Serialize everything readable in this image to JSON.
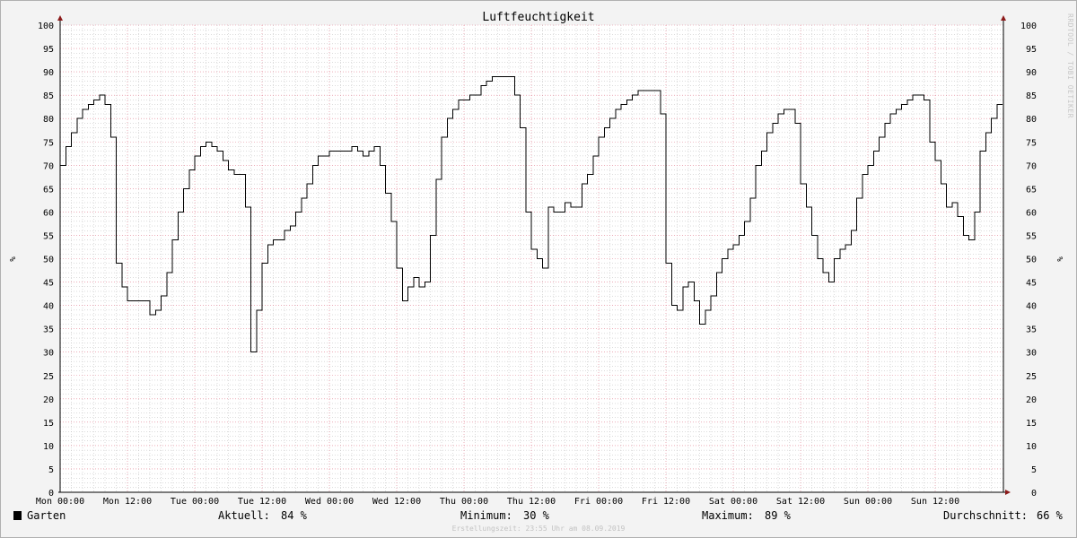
{
  "chart_data": {
    "type": "line",
    "title": "Luftfeuchtigkeit",
    "ylabel": "%",
    "ylim": [
      0,
      100
    ],
    "yticks": [
      0,
      5,
      10,
      15,
      20,
      25,
      30,
      35,
      40,
      45,
      50,
      55,
      60,
      65,
      70,
      75,
      80,
      85,
      90,
      95,
      100
    ],
    "xlabels": [
      "Mon 00:00",
      "Mon 12:00",
      "Tue 00:00",
      "Tue 12:00",
      "Wed 00:00",
      "Wed 12:00",
      "Thu 00:00",
      "Thu 12:00",
      "Fri 00:00",
      "Fri 12:00",
      "Sat 00:00",
      "Sat 12:00",
      "Sun 00:00",
      "Sun 12:00"
    ],
    "xlim_hours": [
      0,
      168
    ],
    "grid": true,
    "series": [
      {
        "name": "Garten",
        "color": "#000000",
        "x_hours": [
          0,
          1,
          2,
          3,
          4,
          5,
          6,
          7,
          8,
          9,
          10,
          11,
          12,
          13,
          14,
          15,
          16,
          17,
          18,
          19,
          20,
          21,
          22,
          23,
          24,
          25,
          26,
          27,
          28,
          29,
          30,
          31,
          32,
          33,
          34,
          35,
          36,
          37,
          38,
          39,
          40,
          41,
          42,
          43,
          44,
          45,
          46,
          47,
          48,
          49,
          50,
          51,
          52,
          53,
          54,
          55,
          56,
          57,
          58,
          59,
          60,
          61,
          62,
          63,
          64,
          65,
          66,
          67,
          68,
          69,
          70,
          71,
          72,
          73,
          74,
          75,
          76,
          77,
          78,
          79,
          80,
          81,
          82,
          83,
          84,
          85,
          86,
          87,
          88,
          89,
          90,
          91,
          92,
          93,
          94,
          95,
          96,
          97,
          98,
          99,
          100,
          101,
          102,
          103,
          104,
          105,
          106,
          107,
          108,
          109,
          110,
          111,
          112,
          113,
          114,
          115,
          116,
          117,
          118,
          119,
          120,
          121,
          122,
          123,
          124,
          125,
          126,
          127,
          128,
          129,
          130,
          131,
          132,
          133,
          134,
          135,
          136,
          137,
          138,
          139,
          140,
          141,
          142,
          143,
          144,
          145,
          146,
          147,
          148,
          149,
          150,
          151,
          152,
          153,
          154,
          155,
          156,
          157,
          158,
          159,
          160,
          161,
          162,
          163,
          164,
          165,
          166,
          167
        ],
        "values": [
          70,
          74,
          77,
          80,
          82,
          83,
          84,
          85,
          83,
          76,
          49,
          44,
          41,
          41,
          41,
          41,
          38,
          39,
          42,
          47,
          54,
          60,
          65,
          69,
          72,
          74,
          75,
          74,
          73,
          71,
          69,
          68,
          68,
          61,
          30,
          39,
          49,
          53,
          54,
          54,
          56,
          57,
          60,
          63,
          66,
          70,
          72,
          72,
          73,
          73,
          73,
          73,
          74,
          73,
          72,
          73,
          74,
          70,
          64,
          58,
          48,
          41,
          44,
          46,
          44,
          45,
          55,
          67,
          76,
          80,
          82,
          84,
          84,
          85,
          85,
          87,
          88,
          89,
          89,
          89,
          89,
          85,
          78,
          60,
          52,
          50,
          48,
          61,
          60,
          60,
          62,
          61,
          61,
          66,
          68,
          72,
          76,
          78,
          80,
          82,
          83,
          84,
          85,
          86,
          86,
          86,
          86,
          81,
          49,
          40,
          39,
          44,
          45,
          41,
          36,
          39,
          42,
          47,
          50,
          52,
          53,
          55,
          58,
          63,
          70,
          73,
          77,
          79,
          81,
          82,
          82,
          79,
          66,
          61,
          55,
          50,
          47,
          45,
          50,
          52,
          53,
          56,
          63,
          68,
          70,
          73,
          76,
          79,
          81,
          82,
          83,
          84,
          85,
          85,
          84,
          75,
          71,
          66,
          61,
          62,
          59,
          55,
          54,
          60,
          73,
          77,
          80,
          83,
          84
        ]
      }
    ]
  },
  "watermark": "RRDTOOL / TOBI OETIKER",
  "legend": {
    "series_label": "Garten",
    "current_label": "Aktuell:",
    "current_value": "84 %",
    "min_label": "Minimum:",
    "min_value": "30 %",
    "max_label": "Maximum:",
    "max_value": "89 %",
    "avg_label": "Durchschnitt:",
    "avg_value": "66 %"
  },
  "footer": "Erstellungszeit: 23:55 Uhr am 08.09.2019",
  "colors": {
    "major_grid": "#e27b8e",
    "minor_grid": "#b8b8b8",
    "background": "#f3f3f3",
    "plot": "#ffffff",
    "axis_arrow": "#8b1a1a"
  }
}
